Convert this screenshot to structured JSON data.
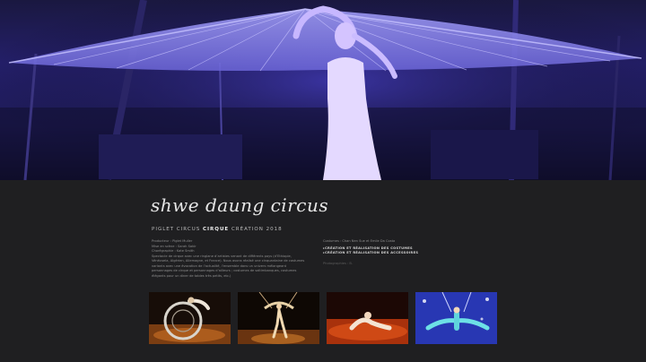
{
  "hero": {
    "image": "circus-performer-umbrella-photo"
  },
  "show": {
    "title": "shwe daung circus",
    "subtitle_prefix": "PIGLET CIRCUS",
    "subtitle_bold": "CIRQUE",
    "subtitle_suffix": "CRÉATION 2018"
  },
  "credits": {
    "producteur": "Producteur : Piglet Muller",
    "mise_en_scene": "Mise en scène : Sarah Sakir",
    "choregraphie": "Chorégraphie : Kate Smith",
    "description": "Spectacle de cirque avec une ringlane d’artistes venant de différents pays (d’Ethiopie, Vénézuela, Algérien, Allemagne, et France). Nous avons réalisé une cinquantaine de costumes variants avec une évocation de l’actualité, l’ensemble dans un univers mélangeant personnages de cirque et personnages d’ailleurs ; costumes de saltimbanques, costumes élégants pour un diner de tables très petits, etc.)"
  },
  "right": {
    "costumes": "Costumes : Chan Nen Sue et Emile Da Costa",
    "items": [
      "CRÉATION ET RÉALISATION DES COSTUMES",
      "CRÉATION ET RÉALISATION DES ACCESSOIRES"
    ],
    "photo_credit": "Photographies : B."
  },
  "gallery": [
    {
      "name": "wheel-act-photo"
    },
    {
      "name": "trapeze-duo-photo"
    },
    {
      "name": "floor-contortion-photo"
    },
    {
      "name": "aerial-blue-suit-photo"
    }
  ]
}
